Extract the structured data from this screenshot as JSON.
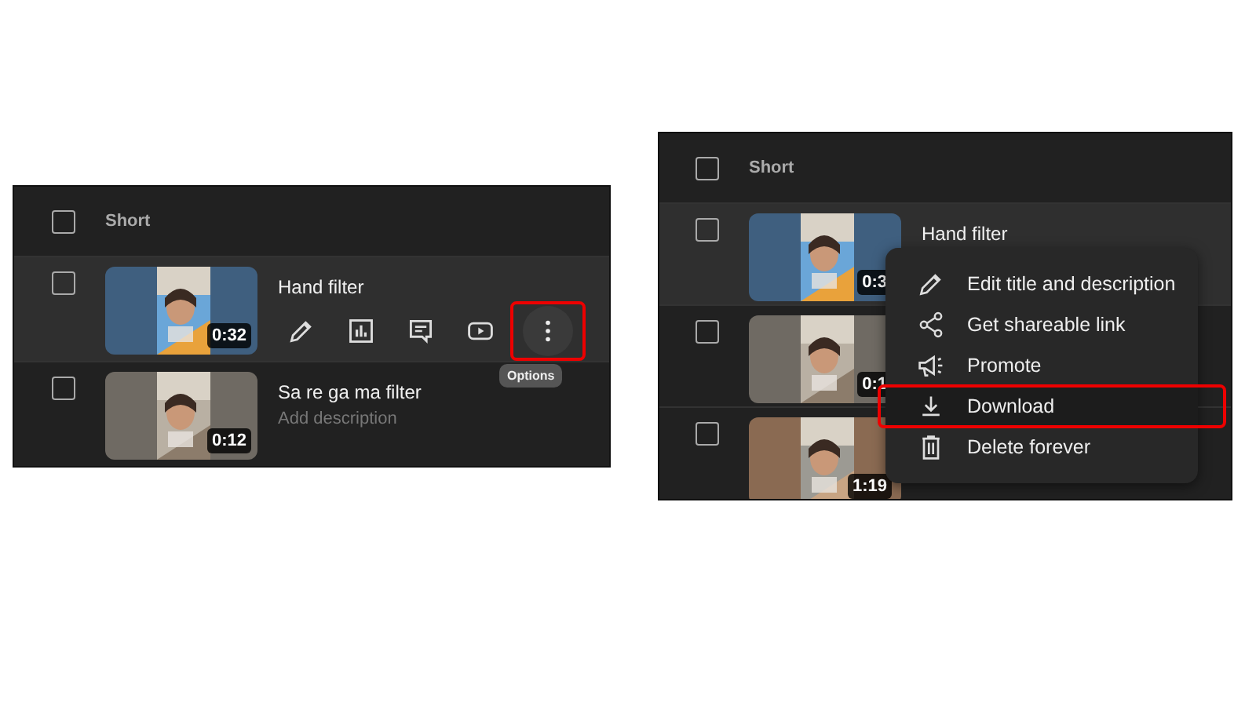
{
  "panels": [
    {
      "header": "Short",
      "header_checked": false,
      "rows": [
        {
          "checked": false,
          "hovered": true,
          "title": "Hand filter",
          "duration": "0:32",
          "actions": [
            {
              "kind": "edit"
            },
            {
              "kind": "analytics"
            },
            {
              "kind": "comments"
            },
            {
              "kind": "youtube"
            },
            {
              "kind": "options",
              "selected": true
            }
          ],
          "tooltip": "Options"
        },
        {
          "checked": false,
          "hovered": false,
          "title": "Sa re ga ma filter",
          "description": "Add description",
          "duration": "0:12"
        }
      ]
    },
    {
      "header": "Short",
      "header_checked": false,
      "rows": [
        {
          "checked": false,
          "hovered": true,
          "title": "Hand filter",
          "duration": "0:3"
        },
        {
          "checked": false,
          "hovered": false,
          "duration": "0:1"
        },
        {
          "checked": false,
          "hovered": false,
          "duration": "1:19"
        }
      ],
      "menu": [
        {
          "kind": "edit",
          "label": "Edit title and description",
          "selected": false
        },
        {
          "kind": "share",
          "label": "Get shareable link",
          "selected": false
        },
        {
          "kind": "promote",
          "label": "Promote",
          "selected": false
        },
        {
          "kind": "download",
          "label": "Download",
          "selected": true
        },
        {
          "kind": "delete",
          "label": "Delete forever",
          "selected": false
        }
      ]
    }
  ]
}
